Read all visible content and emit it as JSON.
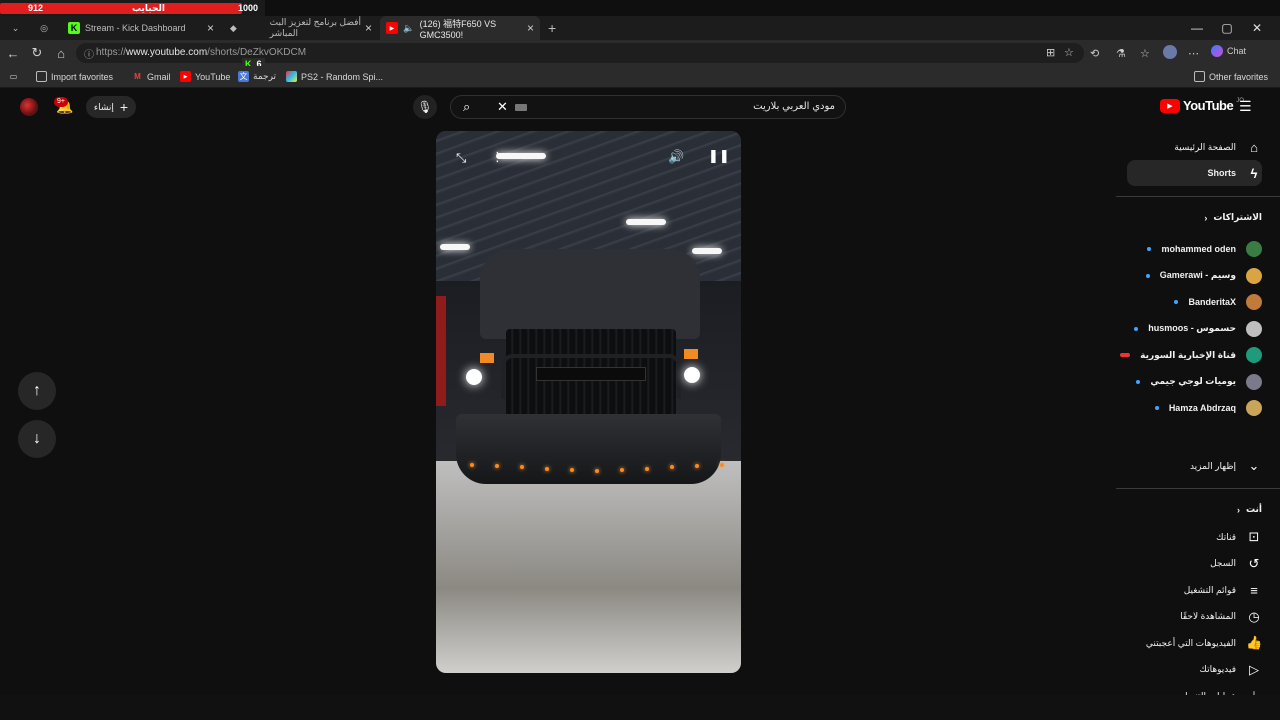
{
  "overlay": {
    "left_value": "912",
    "label": "الحبايب",
    "right_value": "1000",
    "progress_fraction": 0.912
  },
  "tabs": [
    {
      "title": "",
      "icon": "globe-icon"
    },
    {
      "title": "Stream - Kick Dashboard",
      "icon": "kick-icon"
    },
    {
      "title": "أفضل برنامج لتعزيز البث المباشر",
      "icon": "app-icon"
    },
    {
      "title": "(126) 福特F650 VS GMC3500!",
      "icon": "youtube-icon",
      "active": true
    }
  ],
  "window_controls": {
    "minimize": "—",
    "maximize": "▢",
    "close": "✕"
  },
  "address_bar": {
    "url_prefix": "https://",
    "url_host": "www.youtube.com",
    "url_path": "/shorts/DeZkvOKDCM",
    "chat_label": "Chat"
  },
  "kick_badge": {
    "count": "6"
  },
  "bookmarks": [
    {
      "label": "Import favorites",
      "icon": "import-icon"
    },
    {
      "label": "Gmail",
      "icon": "gmail-icon"
    },
    {
      "label": "YouTube",
      "icon": "youtube-icon"
    },
    {
      "label": "ترجمة",
      "icon": "translate-icon"
    },
    {
      "label": "PS2 - Random Spi...",
      "icon": "ps2-icon"
    }
  ],
  "other_favorites": "Other favorites",
  "youtube": {
    "logo_text": "YouTube",
    "logo_sup": "JO",
    "search_value": "مودي العربي بلاريت",
    "create_label": "إنشاء",
    "notifications_badge": "9+"
  },
  "sidebar": {
    "home": "الصفحة الرئيسية",
    "shorts": "Shorts",
    "subscriptions_heading": "الاشتراكات",
    "subscriptions": [
      {
        "name": "mohammed oden",
        "indicator": "new",
        "avatar_color": "#3a7d44"
      },
      {
        "name": "Gamerawi - وسيم",
        "indicator": "new",
        "avatar_color": "#d9a441"
      },
      {
        "name": "BanderitaX",
        "indicator": "new",
        "avatar_color": "#c07a3a"
      },
      {
        "name": "husmoos - حسموس",
        "indicator": "new",
        "avatar_color": "#bfbfbf"
      },
      {
        "name": "قناة الإخبارية السورية",
        "indicator": "live",
        "avatar_color": "#1f9a7a"
      },
      {
        "name": "يوميات لوجي جيمي",
        "indicator": "new",
        "avatar_color": "#7a7a8a"
      },
      {
        "name": "Hamza Abdrzaq",
        "indicator": "new",
        "avatar_color": "#c9a45a"
      }
    ],
    "show_more": "إظهار المزيد",
    "you_heading": "أنت",
    "you_items": [
      {
        "label": "قناتك",
        "icon": "account-icon"
      },
      {
        "label": "السجل",
        "icon": "history-icon"
      },
      {
        "label": "قوائم التشغيل",
        "icon": "playlists-icon"
      },
      {
        "label": "المشاهدة لاحقًا",
        "icon": "watch-later-icon"
      },
      {
        "label": "الفيديوهات التي أعجبتني",
        "icon": "like-icon"
      },
      {
        "label": "فيديوهاتك",
        "icon": "your-videos-icon"
      },
      {
        "label": "عمليات التنزيل",
        "icon": "download-icon"
      }
    ]
  }
}
